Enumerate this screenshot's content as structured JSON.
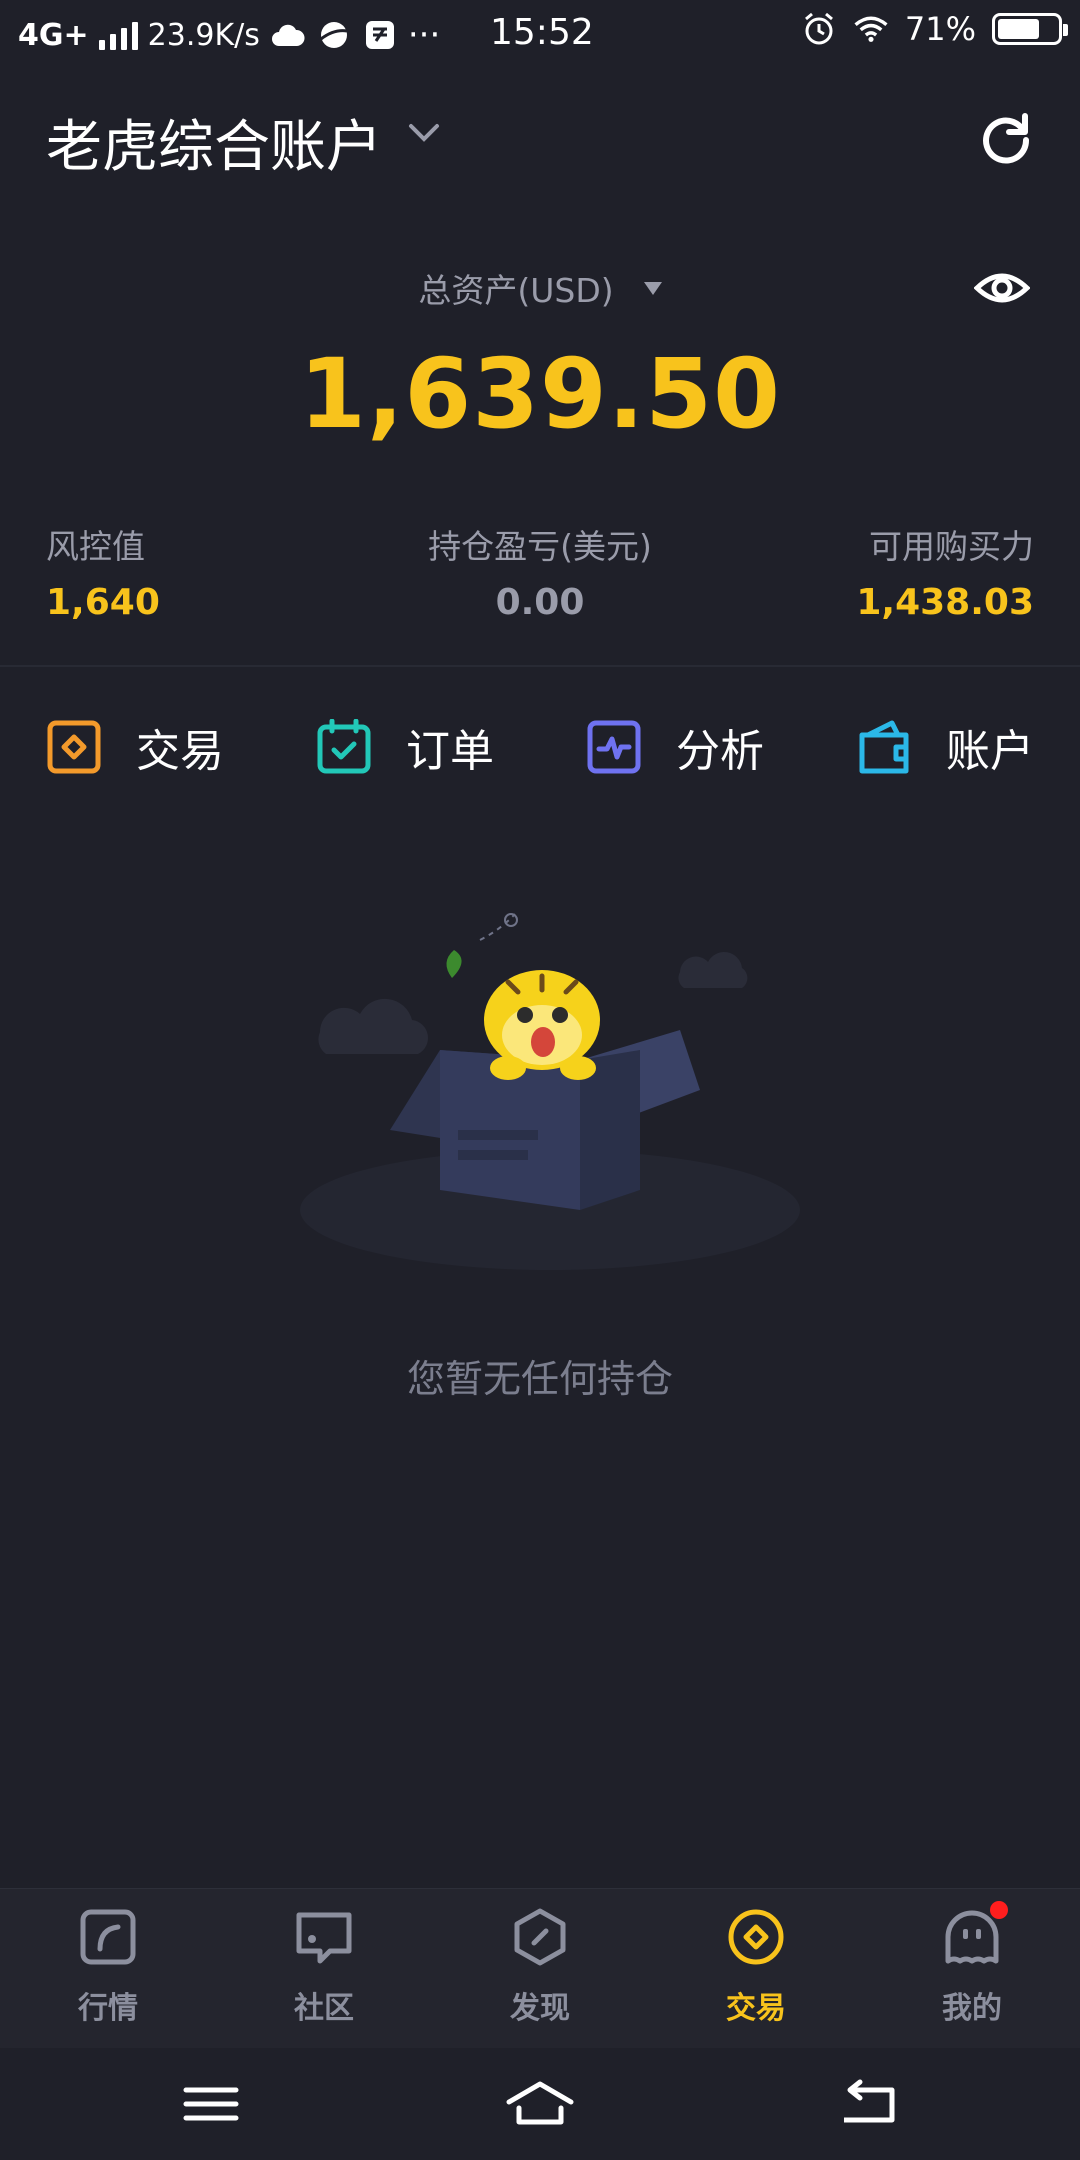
{
  "status_bar": {
    "network": "4G+",
    "speed": "23.9K/s",
    "more": "···",
    "time": "15:52",
    "battery_percent": "71%",
    "battery_level": 0.71
  },
  "header": {
    "account_title": "老虎综合账户"
  },
  "assets": {
    "label": "总资产(USD)",
    "total_value": "1,639.50"
  },
  "metrics": [
    {
      "label": "风控值",
      "value": "1,640"
    },
    {
      "label": "持仓盈亏(美元)",
      "value": "0.00"
    },
    {
      "label": "可用购买力",
      "value": "1,438.03"
    }
  ],
  "actions": [
    {
      "label": "交易",
      "icon": "trade-icon",
      "color": "#f39a2b"
    },
    {
      "label": "订单",
      "icon": "order-icon",
      "color": "#22c8b8"
    },
    {
      "label": "分析",
      "icon": "analysis-icon",
      "color": "#6f72f0"
    },
    {
      "label": "账户",
      "icon": "wallet-icon",
      "color": "#2bb8e8"
    }
  ],
  "empty_state": {
    "message": "您暂无任何持仓"
  },
  "bottom_nav": [
    {
      "label": "行情",
      "icon": "market-icon",
      "active": false
    },
    {
      "label": "社区",
      "icon": "community-icon",
      "active": false
    },
    {
      "label": "发现",
      "icon": "discover-icon",
      "active": false
    },
    {
      "label": "交易",
      "icon": "trade-nav-icon",
      "active": true
    },
    {
      "label": "我的",
      "icon": "profile-icon",
      "active": false,
      "badge": true
    }
  ],
  "colors": {
    "background": "#1f2029",
    "accent": "#f8c31c",
    "muted": "#9a9caa",
    "badge": "#ff1e1e"
  }
}
